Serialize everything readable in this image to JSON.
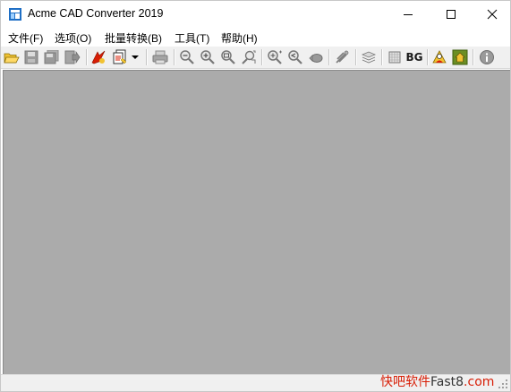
{
  "window": {
    "title": "Acme CAD Converter 2019",
    "icon": "acme-app-icon"
  },
  "menubar": {
    "items": [
      {
        "label": "文件(F)"
      },
      {
        "label": "选项(O)"
      },
      {
        "label": "批量转换(B)"
      },
      {
        "label": "工具(T)"
      },
      {
        "label": "帮助(H)"
      }
    ]
  },
  "toolbar": {
    "bg_label": "BG",
    "icons": [
      "open-folder-icon",
      "save-icon",
      "save-as-icon",
      "export-icon",
      "convert-icon",
      "batch-convert-icon",
      "dropdown-arrow-icon",
      "print-icon",
      "zoom-out-icon",
      "zoom-in-icon",
      "zoom-window-icon",
      "zoom-extents-icon",
      "zoom-realtime-icon",
      "zoom-previous-icon",
      "pan-icon",
      "measure-icon",
      "layers-icon",
      "grid-icon",
      "background-toggle",
      "user-icon",
      "home-icon",
      "info-icon"
    ]
  },
  "watermark": {
    "part1": "快吧软件",
    "part2": "Fast8",
    "part3": ".com"
  },
  "colors": {
    "workspace_bg": "#ababab",
    "toolbar_bg": "#f0f0f0",
    "watermark_red": "#d81e06"
  }
}
